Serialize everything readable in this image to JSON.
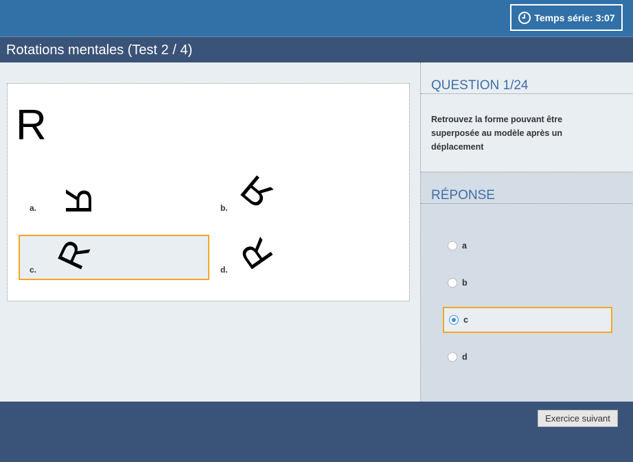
{
  "timer": {
    "icon": "clock-icon",
    "text": "Temps série: 3:07"
  },
  "header": {
    "title": "Rotations mentales (Test 2 / 4)"
  },
  "puzzle": {
    "model_letter": "R",
    "options": [
      {
        "label": "a.",
        "glyph": "R"
      },
      {
        "label": "b.",
        "glyph": "R"
      },
      {
        "label": "c.",
        "glyph": "R"
      },
      {
        "label": "d.",
        "glyph": "R"
      }
    ]
  },
  "question": {
    "heading": "QUESTION 1/24",
    "text": "Retrouvez la forme pouvant être superposée au modèle après un déplacement"
  },
  "answer": {
    "heading": "RÉPONSE",
    "choices": [
      {
        "label": "a",
        "checked": false
      },
      {
        "label": "b",
        "checked": false
      },
      {
        "label": "c",
        "checked": true
      },
      {
        "label": "d",
        "checked": false
      }
    ]
  },
  "footer": {
    "next_label": "Exercice suivant"
  },
  "colors": {
    "top_bar": "#3271a8",
    "title_bar": "#3a5379",
    "selection": "#f6a623",
    "heading": "#3d6fa6"
  }
}
